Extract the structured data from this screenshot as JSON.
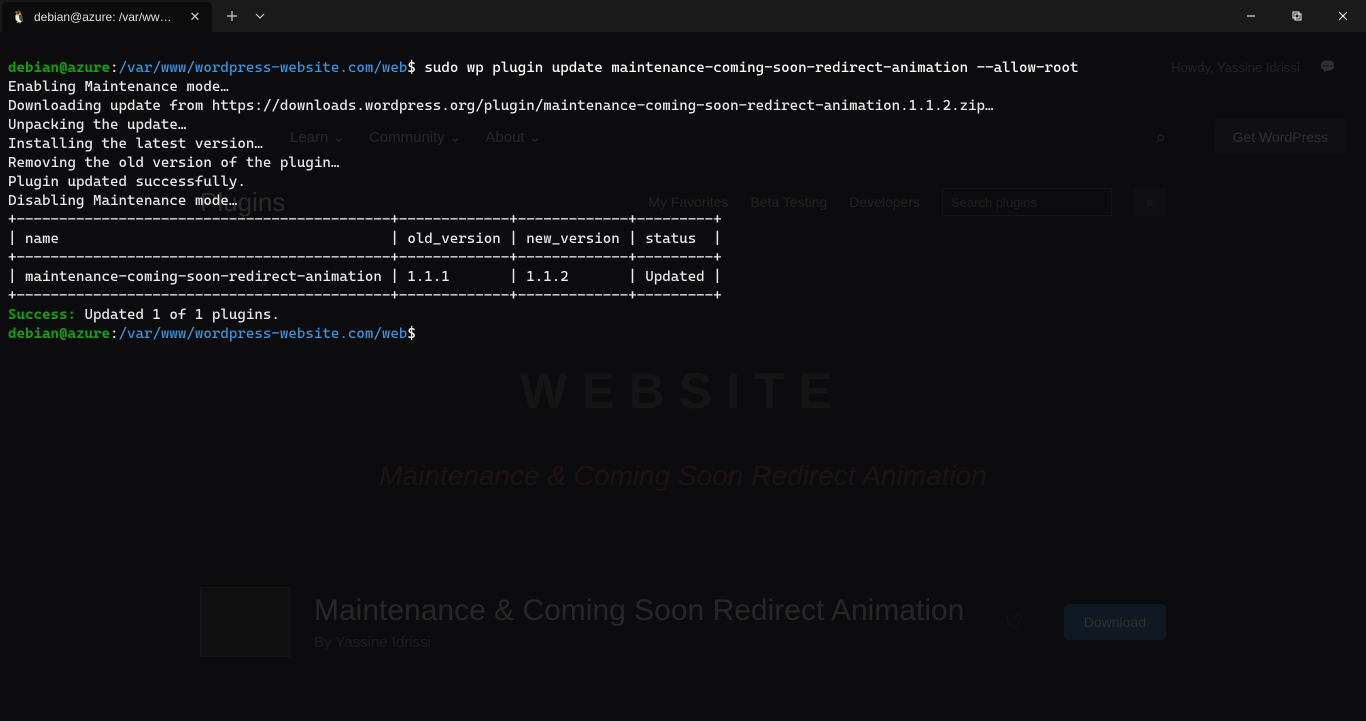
{
  "window": {
    "tab_title": "debian@azure: /var/www/wo",
    "tab_icon": "penguin-icon"
  },
  "prompt": {
    "user_host": "debian@azure",
    "colon": ":",
    "path": "/var/www/wordpress-website.com/web",
    "dollar": "$",
    "command": " sudo wp plugin update maintenance-coming-soon-redirect-animation --allow-root"
  },
  "output": {
    "lines": [
      "Enabling Maintenance mode…",
      "Downloading update from https://downloads.wordpress.org/plugin/maintenance-coming-soon-redirect-animation.1.1.2.zip…",
      "Unpacking the update…",
      "Installing the latest version…",
      "Removing the old version of the plugin…",
      "Plugin updated successfully.",
      "Disabling Maintenance mode…"
    ],
    "table_border_top": "+--------------------------------------------+-------------+-------------+---------+",
    "table_header": "| name                                       | old_version | new_version | status  |",
    "table_border_mid": "+--------------------------------------------+-------------+-------------+---------+",
    "table_row": "| maintenance-coming-soon-redirect-animation | 1.1.1       | 1.1.2       | Updated |",
    "table_border_bot": "+--------------------------------------------+-------------+-------------+---------+",
    "success_label": "Success:",
    "success_msg": " Updated 1 of 1 plugins."
  },
  "prompt2": {
    "user_host": "debian@azure",
    "colon": ":",
    "path": "/var/www/wordpress-website.com/web",
    "dollar": "$"
  },
  "bg": {
    "howdy": "Howdy, Yassine Idrissi",
    "nav": {
      "learn": "Learn",
      "community": "Community",
      "about": "About",
      "get_wp": "Get WordPress"
    },
    "subnav": {
      "title": "Plugins",
      "my_fav": "My Favorites",
      "beta": "Beta Testing",
      "dev": "Developers",
      "search_placeholder": "Search plugins"
    },
    "banner": {
      "title": "WEBSITE",
      "subtitle": "Maintenance & Coming Soon Redirect Animation"
    },
    "plugin": {
      "title": "Maintenance & Coming Soon Redirect Animation",
      "author": "By Yassine Idrissi",
      "download": "Download"
    }
  }
}
